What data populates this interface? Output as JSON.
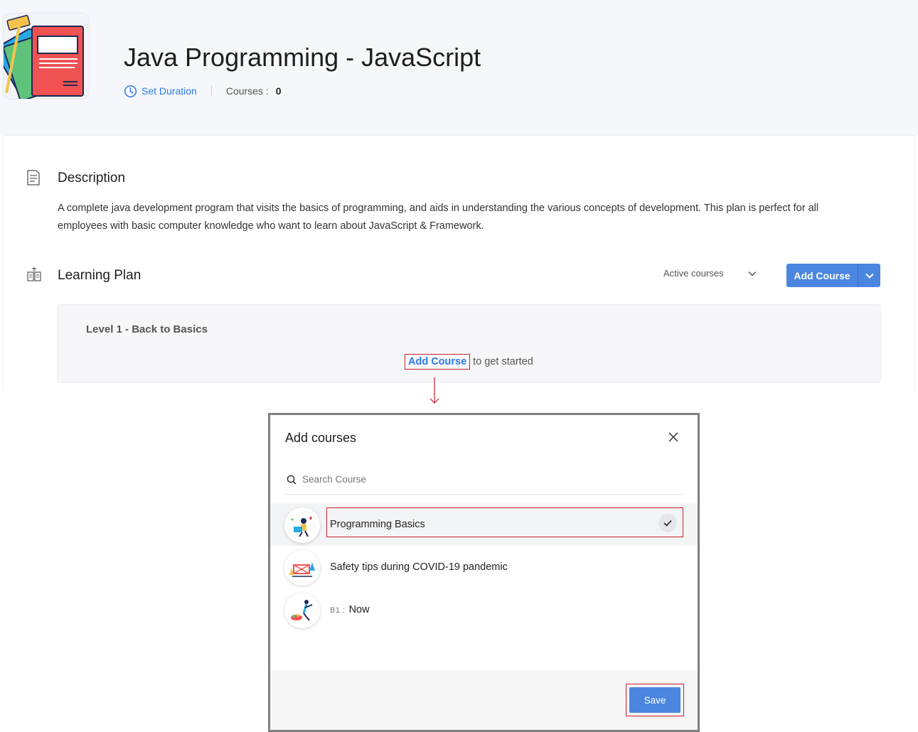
{
  "header": {
    "title": "Java Programming - JavaScript",
    "set_duration": "Set Duration",
    "courses_label": "Courses :",
    "courses_count": "0"
  },
  "description": {
    "heading": "Description",
    "text": "A complete java development program that visits the basics of programming, and aids in understanding the various concepts of development. This plan is perfect for all employees with basic computer knowledge who want to learn about JavaScript & Framework."
  },
  "learning_plan": {
    "heading": "Learning Plan",
    "filter_value": "Active courses",
    "add_course_label": "Add Course",
    "level_title": "Level 1 - Back to Basics",
    "empty_link": "Add Course",
    "empty_text": "to get started"
  },
  "modal": {
    "title": "Add courses",
    "search_placeholder": "Search Course",
    "courses": [
      {
        "name": "Programming Basics",
        "selected": true,
        "prefix": ""
      },
      {
        "name": "Safety tips during COVID-19 pandemic",
        "selected": false,
        "prefix": ""
      },
      {
        "name": "Now",
        "selected": false,
        "prefix": "B1 :"
      }
    ],
    "save_label": "Save"
  },
  "colors": {
    "accent": "#4a86e0",
    "link": "#2d7be5",
    "highlight": "#c6202a"
  }
}
